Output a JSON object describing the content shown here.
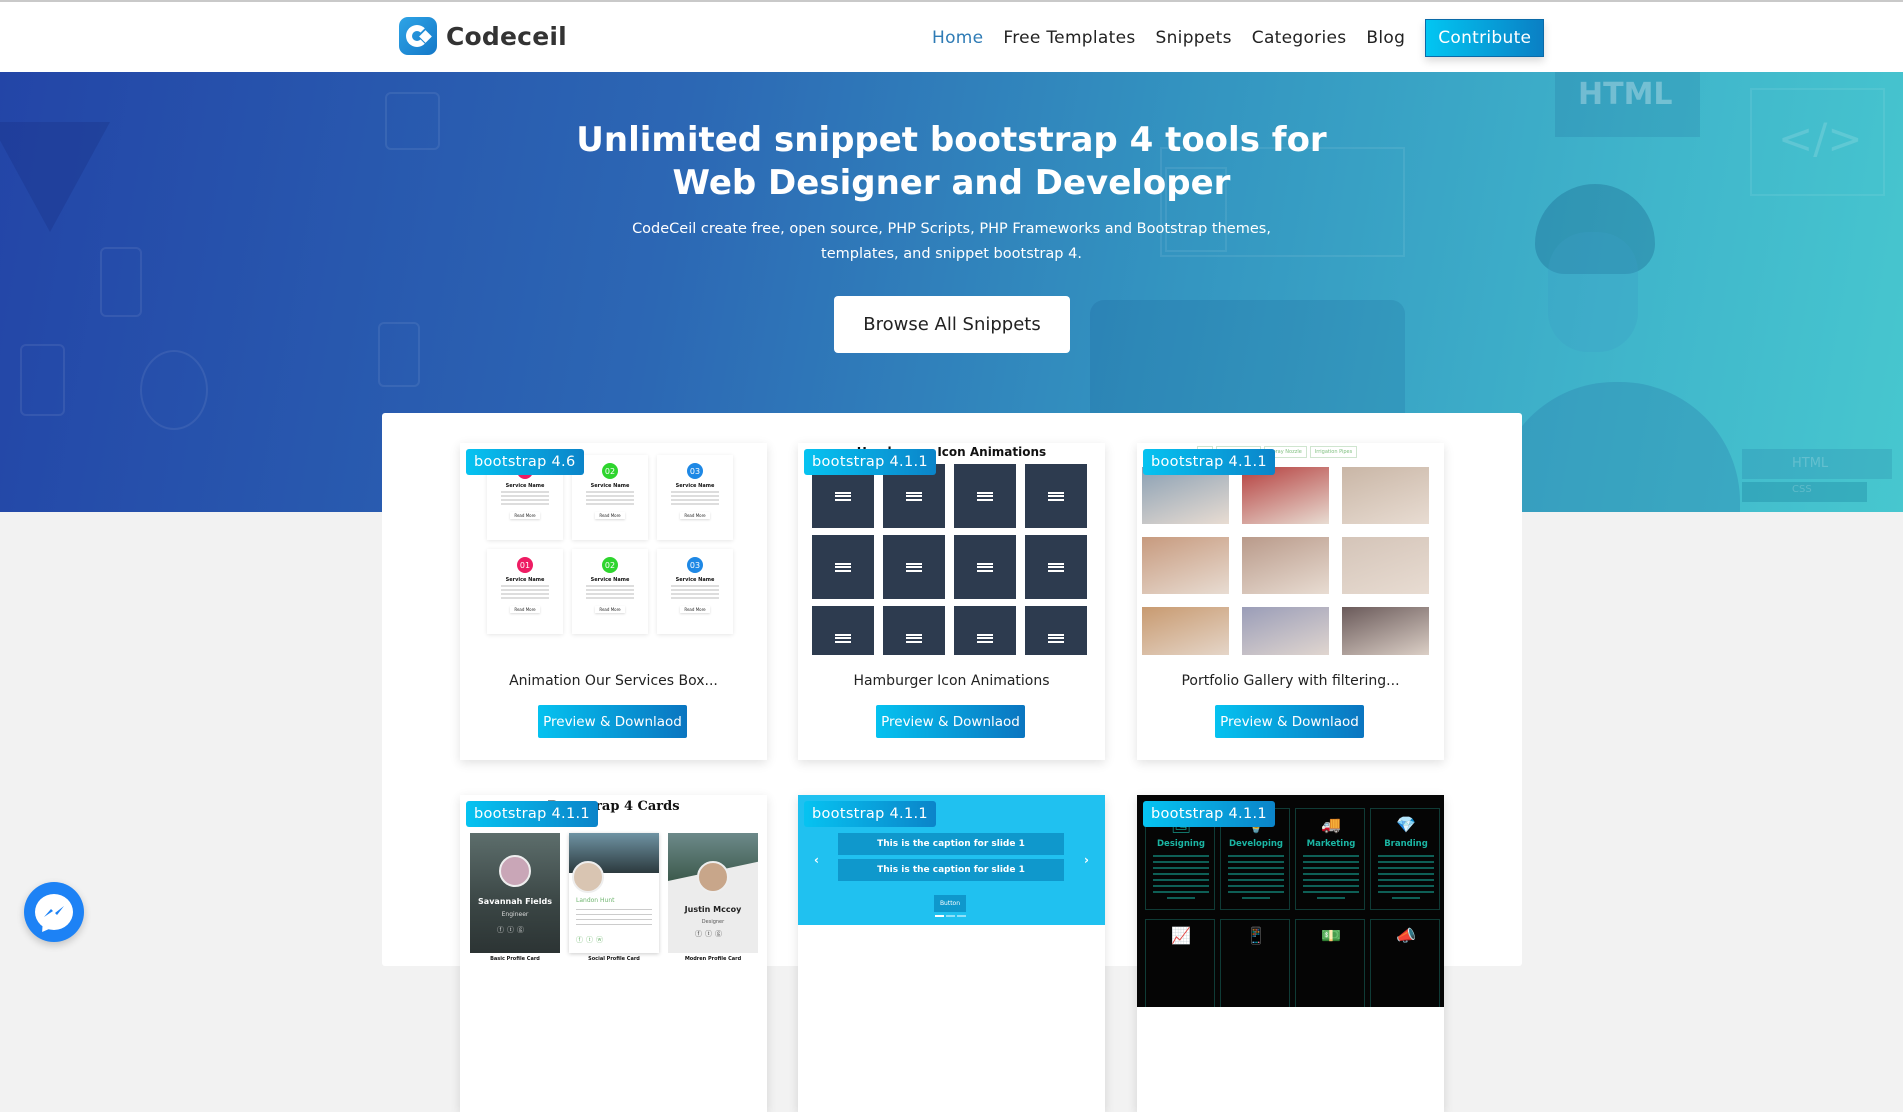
{
  "brand": {
    "name": "Codeceil"
  },
  "nav": {
    "items": [
      {
        "label": "Home",
        "active": true
      },
      {
        "label": "Free Templates",
        "active": false
      },
      {
        "label": "Snippets",
        "active": false
      },
      {
        "label": "Categories",
        "active": false
      },
      {
        "label": "Blog",
        "active": false
      }
    ],
    "cta_label": "Contribute"
  },
  "hero": {
    "title_line1": "Unlimited snippet bootstrap 4 tools for",
    "title_line2": "Web Designer and Developer",
    "subtitle": "CodeCeil create free, open source, PHP Scripts, PHP Frameworks and Bootstrap themes, templates, and snippet bootstrap 4.",
    "button_label": "Browse All Snippets",
    "bg_labels": {
      "html": "HTML",
      "html_small": "HTML",
      "css_small": "CSS"
    }
  },
  "colors": {
    "accent": "#05c2f0",
    "accent_dark": "#0a75c0",
    "nav_active": "#2e7bb5",
    "hero_start": "#2345a7",
    "hero_end": "#47c7cf",
    "messenger": "#1d82f5"
  },
  "cards": [
    {
      "badge": "bootstrap 4.6",
      "title": "Animation Our Services Box...",
      "button": "Preview & Downlaod",
      "thumb": {
        "type": "services",
        "items": [
          {
            "num": "01",
            "color": "#ee1c63",
            "name": "Service Name",
            "more": "Read More"
          },
          {
            "num": "02",
            "color": "#2ed52e",
            "name": "Service Name",
            "more": "Read More"
          },
          {
            "num": "03",
            "color": "#1e88e5",
            "name": "Service Name",
            "more": "Read More"
          },
          {
            "num": "01",
            "color": "#ee1c63",
            "name": "Service Name",
            "more": "Read More"
          },
          {
            "num": "02",
            "color": "#2ed52e",
            "name": "Service Name",
            "more": "Read More"
          },
          {
            "num": "03",
            "color": "#1e88e5",
            "name": "Service Name",
            "more": "Read More"
          }
        ]
      }
    },
    {
      "badge": "bootstrap 4.1.1",
      "title": "Hamburger Icon Animations",
      "button": "Preview & Downlaod",
      "thumb": {
        "type": "hamburger",
        "heading": "Hamburger Icon Animations",
        "count": 12
      }
    },
    {
      "badge": "bootstrap 4.1.1",
      "title": "Portfolio Gallery with filtering...",
      "button": "Preview & Downlaod",
      "thumb": {
        "type": "gallery",
        "filters": [
          "All",
          "Sprinkle Pipes",
          "Spray Nozzle",
          "Irrigation Pipes"
        ],
        "image_colors": [
          "#8aa0b4",
          "#b5403f",
          "#c9b6a6",
          "#c79a7e",
          "#b99a8a",
          "#d4c4b8",
          "#c89a70",
          "#9a9db8",
          "#6a5a5a"
        ]
      }
    },
    {
      "badge": "bootstrap 4.1.1",
      "title": "",
      "button": "",
      "thumb": {
        "type": "profiles",
        "heading": "Bootstrap 4 Cards",
        "profiles": [
          {
            "name": "Savannah Fields",
            "role": "Engineer",
            "caption": "Basic Profile Card"
          },
          {
            "name": "Landon Hunt",
            "role": "",
            "caption": "Social Profile Card"
          },
          {
            "name": "Justin Mccoy",
            "role": "Designer",
            "caption": "Modren Profile Card"
          }
        ]
      }
    },
    {
      "badge": "bootstrap 4.1.1",
      "title": "",
      "button": "",
      "thumb": {
        "type": "carousel",
        "captions": [
          "This is the caption for slide 1",
          "This is the caption for slide 1"
        ],
        "button": "Button",
        "prev": "‹",
        "next": "›"
      }
    },
    {
      "badge": "bootstrap 4.1.1",
      "title": "",
      "button": "",
      "thumb": {
        "type": "dark-services",
        "items": [
          {
            "label": "Designing",
            "icon": "🖼"
          },
          {
            "label": "Developing",
            "icon": "💡"
          },
          {
            "label": "Marketing",
            "icon": "🚚"
          },
          {
            "label": "Branding",
            "icon": "💎"
          }
        ],
        "row2_icons": [
          "📈",
          "📱",
          "💵",
          "📣"
        ]
      }
    }
  ]
}
